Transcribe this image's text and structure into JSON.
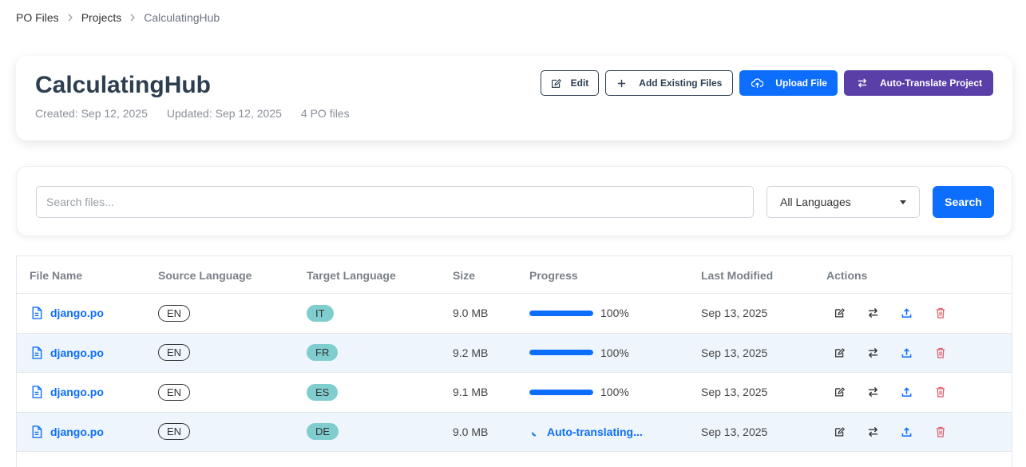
{
  "breadcrumb": [
    "PO Files",
    "Projects",
    "CalculatingHub"
  ],
  "project": {
    "title": "CalculatingHub",
    "created": "Created: Sep 12, 2025",
    "updated": "Updated: Sep 12, 2025",
    "file_count": "4 PO files"
  },
  "toolbar": {
    "edit_label": "Edit",
    "add_existing_label": "Add Existing Files",
    "upload_label": "Upload File",
    "auto_translate_label": "Auto-Translate Project"
  },
  "search": {
    "placeholder": "Search files...",
    "language_selected": "All Languages",
    "button_label": "Search"
  },
  "table": {
    "headers": [
      "File Name",
      "Source Language",
      "Target Language",
      "Size",
      "Progress",
      "Last Modified",
      "Actions"
    ],
    "rows": [
      {
        "name": "django.po",
        "source": "EN",
        "target": "IT",
        "size": "9.0 MB",
        "progress": 100,
        "progress_label": "100%",
        "modified": "Sep 13, 2025",
        "status": ""
      },
      {
        "name": "django.po",
        "source": "EN",
        "target": "FR",
        "size": "9.2 MB",
        "progress": 100,
        "progress_label": "100%",
        "modified": "Sep 13, 2025",
        "status": ""
      },
      {
        "name": "django.po",
        "source": "EN",
        "target": "ES",
        "size": "9.1 MB",
        "progress": 100,
        "progress_label": "100%",
        "modified": "Sep 13, 2025",
        "status": ""
      },
      {
        "name": "django.po",
        "source": "EN",
        "target": "DE",
        "size": "9.0 MB",
        "progress": null,
        "progress_label": "",
        "modified": "Sep 13, 2025",
        "status": "Auto-translating..."
      }
    ]
  },
  "colors": {
    "primary": "#0d6efd",
    "purple": "#5b3fa8",
    "teal_badge": "#7fcdcf",
    "delete": "#e35d6a",
    "title": "#2d3e50"
  },
  "icons": [
    "chevron-right-icon",
    "edit-icon",
    "plus-icon",
    "cloud-upload-icon",
    "translate-arrows-icon",
    "file-icon",
    "upload-icon",
    "trash-icon",
    "spinner-icon"
  ]
}
